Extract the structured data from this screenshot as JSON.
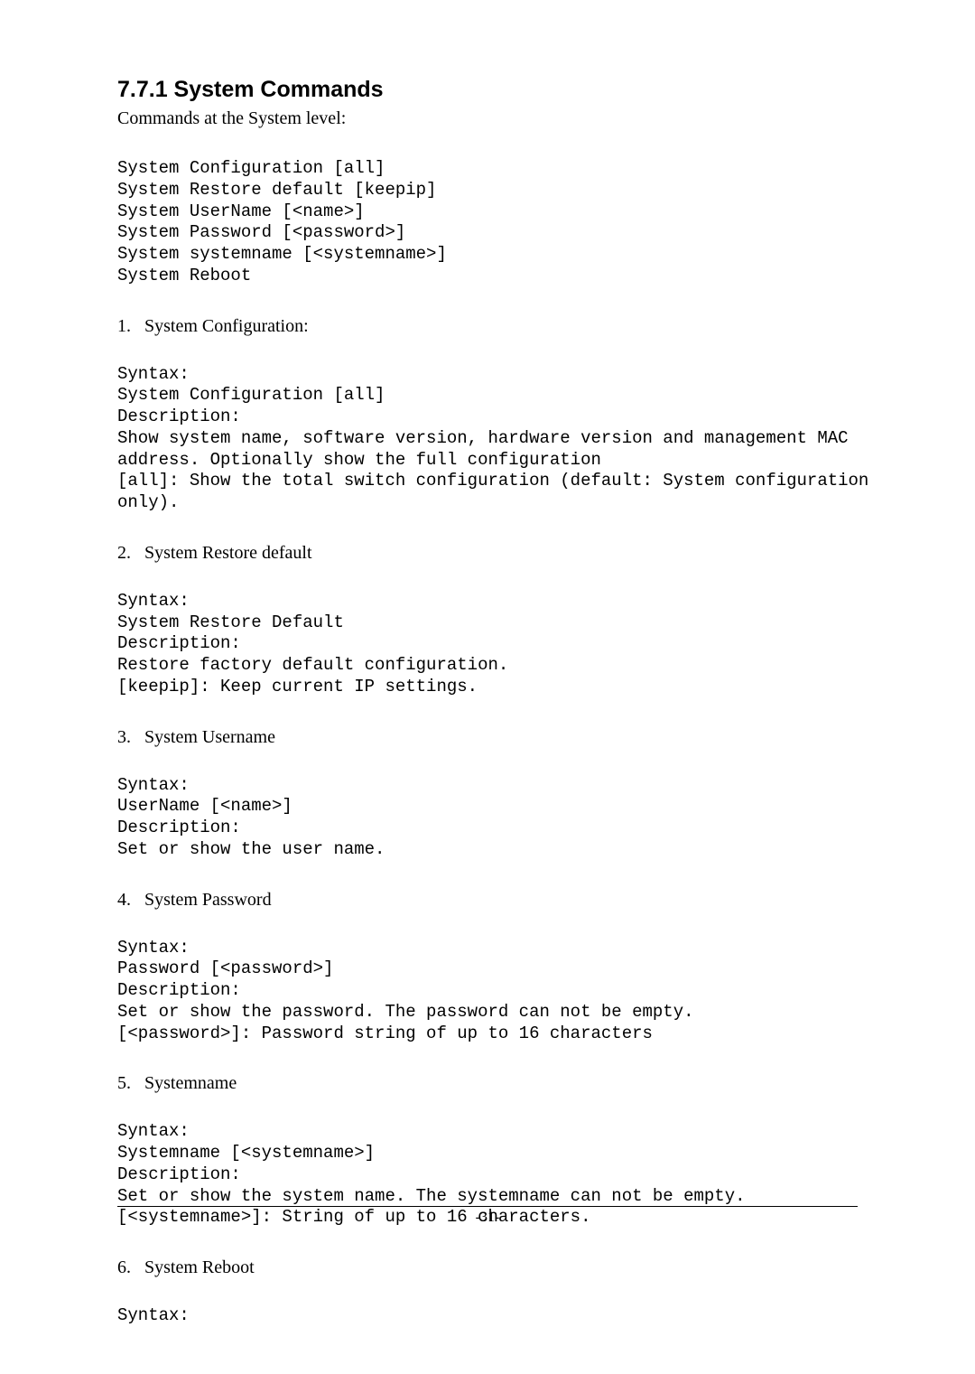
{
  "heading": "7.7.1 System Commands",
  "intro": "Commands at the System level:",
  "overview_code": "System Configuration [all]\nSystem Restore default [keepip]\nSystem UserName [<name>]\nSystem Password [<password>]\nSystem systemname [<systemname>]\nSystem Reboot",
  "items": [
    {
      "num": "1.",
      "title": "System Configuration:",
      "code": "Syntax:\nSystem Configuration [all]\nDescription:\nShow system name, software version, hardware version and management MAC\naddress. Optionally show the full configuration\n[all]: Show the total switch configuration (default: System configuration\nonly)."
    },
    {
      "num": "2.",
      "title": "System Restore default",
      "code": "Syntax:\nSystem Restore Default\nDescription:\nRestore factory default configuration.\n[keepip]: Keep current IP settings."
    },
    {
      "num": "3.",
      "title": "System Username",
      "code": "Syntax:\nUserName [<name>]\nDescription:\nSet or show the user name."
    },
    {
      "num": "4.",
      "title": "System Password",
      "code": "Syntax:\nPassword [<password>]\nDescription:\nSet or show the password. The password can not be empty.\n[<password>]: Password string of up to 16 characters"
    },
    {
      "num": "5.",
      "title": "Systemname",
      "code": "Syntax:\nSystemname [<systemname>]\nDescription:\nSet or show the system name. The systemname can not be empty.\n[<systemname>]: String of up to 16 characters."
    },
    {
      "num": "6.",
      "title": "System Reboot",
      "code": "Syntax:"
    }
  ],
  "page_footer": "-31-"
}
